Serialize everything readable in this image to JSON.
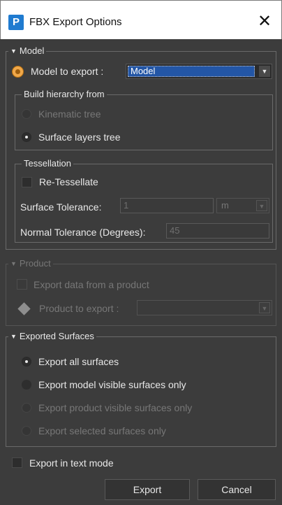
{
  "window": {
    "title": "FBX Export Options",
    "app_icon_letter": "P",
    "close_glyph": "✕"
  },
  "model": {
    "legend": "Model",
    "model_to_export_label": "Model to export :",
    "model_to_export_value": "Model",
    "build_hierarchy": {
      "legend": "Build hierarchy from",
      "kinematic_tree": "Kinematic tree",
      "surface_layers_tree": "Surface layers tree"
    },
    "tessellation": {
      "legend": "Tessellation",
      "retessellate": "Re-Tessellate",
      "surface_tolerance_label": "Surface Tolerance:",
      "surface_tolerance_value": "1",
      "surface_tolerance_unit": "m",
      "normal_tolerance_label": "Normal Tolerance (Degrees):",
      "normal_tolerance_value": "45"
    }
  },
  "product": {
    "legend": "Product",
    "export_from_product": "Export data from a product",
    "product_to_export_label": "Product to export :"
  },
  "exported_surfaces": {
    "legend": "Exported Surfaces",
    "options": [
      "Export all surfaces",
      "Export model visible surfaces only",
      "Export product visible surfaces only",
      "Export selected surfaces only"
    ]
  },
  "export_text_mode": "Export in text mode",
  "buttons": {
    "export": "Export",
    "cancel": "Cancel"
  },
  "colors": {
    "accent_radio": "#f0a84a",
    "selection": "#2356a6",
    "app_icon": "#1f7bd0",
    "background": "#3c3c3c"
  },
  "icons": {
    "collapse_icon": "▼",
    "dropdown_arrow": "▼"
  }
}
